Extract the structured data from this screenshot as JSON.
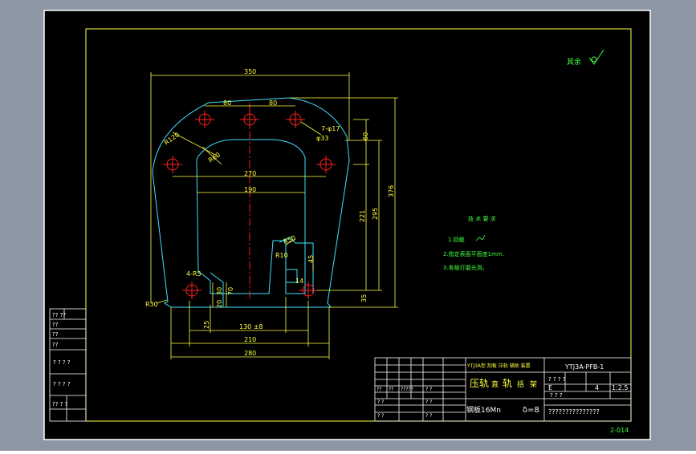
{
  "colors": {
    "viewport_bg": "#8c96a5",
    "sheet_bg": "#000000",
    "border": "#ffff40",
    "part_outline": "#40e0ff",
    "dimension": "#ffff40",
    "centerline": "#ff2020",
    "text_green": "#40ff40",
    "frame_white": "#ffffff"
  },
  "surface_finish": {
    "label": "其余"
  },
  "dimensions": {
    "overall_width": "350",
    "hole_spacing_left": "80",
    "hole_spacing_right": "80",
    "hole_callout_count": "7-φ17",
    "hole_callout_dia": "φ33",
    "vertical_60": "60",
    "radius_outer": "R120",
    "radius_inner": "R60",
    "span_270": "270",
    "span_190": "190",
    "height_221": "221",
    "height_295": "295",
    "height_376": "376",
    "radius_50": "R50",
    "radius_10": "R10",
    "dim_45": "45",
    "dim_14": "14",
    "notch_radius": "4-R5",
    "dim_30": "30",
    "dim_70": "70",
    "dim_20": "20",
    "dim_35": "35",
    "radius_30": "R30",
    "dim_25": "25",
    "dim_130": "130 ±8",
    "span_210": "210",
    "span_280": "280"
  },
  "technical_requirements": {
    "heading": "技 术 要 求",
    "items": [
      "1.回截  ",
      "2.指定表面平面度1mm.",
      "3.各棱打磨光滑。"
    ]
  },
  "title_block": {
    "drawing_number": "YTJ3A-PFB-1",
    "project": "YTJ3A型 刮板 压轨 辅助 装置",
    "part_name_parts": [
      "压轨",
      "直",
      "轨",
      "括",
      "架"
    ],
    "material": "钢板16Mn",
    "thickness": "δ=8",
    "stage_marks": "? ?   ? ?",
    "stage_letter": "E",
    "quantity": "4",
    "scale": "1:2.5",
    "sheet_marks": "?      ?       ?",
    "company": "???????????????",
    "grid_labels": [
      "??",
      "??",
      "?????",
      "? ?",
      "? ?",
      "? ?",
      "? ?",
      "? ?"
    ]
  },
  "left_strip_labels": [
    "?? ??",
    "??",
    "??",
    "??",
    "? ? ? ?",
    "? ? ? ?",
    "?? ? ?"
  ],
  "sheet_code": "2-014"
}
